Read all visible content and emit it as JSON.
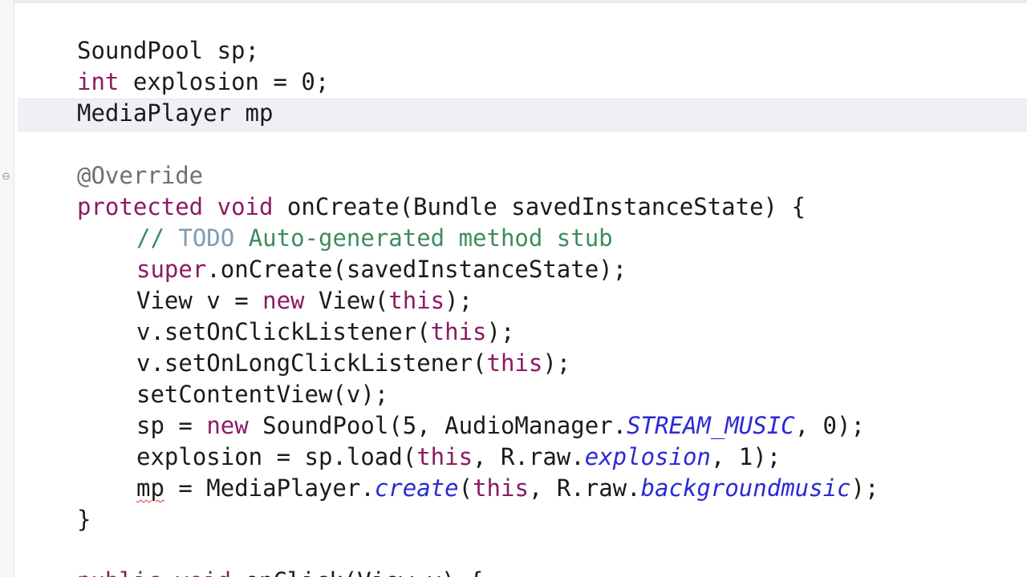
{
  "editor": {
    "fold_icon": "minus-circle-icon",
    "lines": [
      {
        "t0": "SoundPool sp;"
      },
      {
        "t0": "int",
        "t1": " explosion = 0;"
      },
      {
        "t0": "MediaPlayer mp"
      },
      {
        "t0": ""
      },
      {
        "t0": "@Override"
      },
      {
        "t0": "protected",
        "t1": " ",
        "t2": "void",
        "t3": " onCreate(Bundle savedInstanceState) {"
      },
      {
        "t0": "// ",
        "t1": "TODO",
        "t2": " Auto-generated method stub"
      },
      {
        "t0": "super",
        "t1": ".onCreate(savedInstanceState);"
      },
      {
        "t0": "View v = ",
        "t1": "new",
        "t2": " View(",
        "t3": "this",
        "t4": ");"
      },
      {
        "t0": "v.setOnClickListener(",
        "t1": "this",
        "t2": ");"
      },
      {
        "t0": "v.setOnLongClickListener(",
        "t1": "this",
        "t2": ");"
      },
      {
        "t0": "setContentView(v);"
      },
      {
        "t0": "sp = ",
        "t1": "new",
        "t2": " SoundPool(5, AudioManager.",
        "t3": "STREAM_MUSIC",
        "t4": ", 0);"
      },
      {
        "t0": "explosion = sp.load(",
        "t1": "this",
        "t2": ", R.raw.",
        "t3": "explosion",
        "t4": ", 1);"
      },
      {
        "t0": "mp",
        "t1": " = MediaPlayer.",
        "t2": "create",
        "t3": "(",
        "t4": "this",
        "t5": ", R.raw.",
        "t6": "backgroundmusic",
        "t7": ");"
      },
      {
        "t0": "}"
      },
      {
        "t0": "public",
        "t1": " ",
        "t2": "void",
        "t3": " onClick(View v) {"
      }
    ]
  },
  "colors": {
    "keyword": "#8b1a63",
    "comment": "#3f8a5e",
    "todo": "#7d9cb2",
    "annotation": "#707070",
    "static_italic": "#2a2ad6",
    "current_line_highlight": "#eef0f5",
    "error_underline": "#e23030"
  }
}
